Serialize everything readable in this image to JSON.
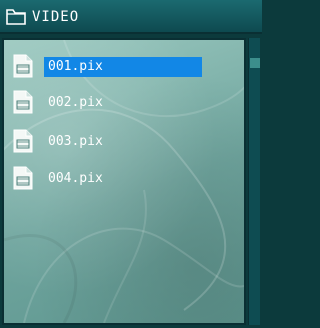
{
  "header": {
    "title": "VIDEO",
    "icon": "folder-icon"
  },
  "files": [
    {
      "name": "001.pix",
      "icon": "film-file-icon",
      "selected": true
    },
    {
      "name": "002.pix",
      "icon": "film-file-icon",
      "selected": false
    },
    {
      "name": "003.pix",
      "icon": "film-file-icon",
      "selected": false
    },
    {
      "name": "004.pix",
      "icon": "film-file-icon",
      "selected": false
    }
  ],
  "colors": {
    "header_bg": "#0e4a50",
    "panel_bg": "#7fb2ab",
    "selection": "#1287e6",
    "text": "#ffffff"
  }
}
